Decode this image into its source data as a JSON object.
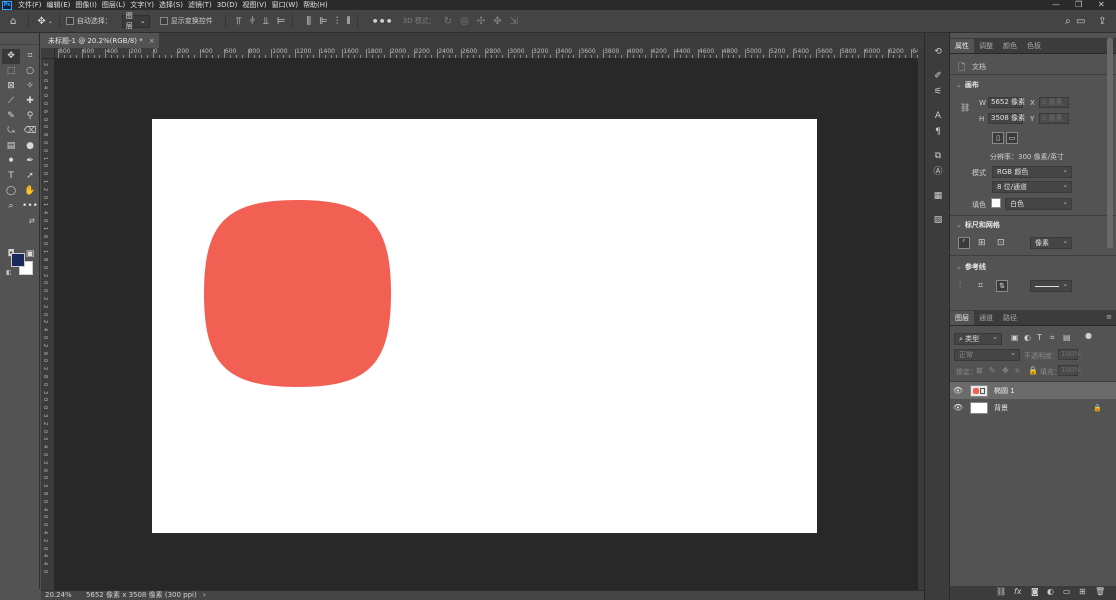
{
  "app": {
    "logo": "Ps"
  },
  "menu": [
    "文件(F)",
    "编辑(E)",
    "图像(I)",
    "图层(L)",
    "文字(Y)",
    "选择(S)",
    "滤镜(T)",
    "3D(D)",
    "视图(V)",
    "窗口(W)",
    "帮助(H)"
  ],
  "window_controls": {
    "minimize": "—",
    "restore": "❐",
    "close": "✕"
  },
  "options": {
    "auto_select_label": "自动选择：",
    "auto_select_target": "图层",
    "show_transform_label": "显示变换控件",
    "mode3d_label": "3D 模式："
  },
  "document_tab": {
    "title": "未标题-1 @ 20.2%(RGB/8) *",
    "close": "×"
  },
  "ruler_top_labels": [
    "800",
    "600",
    "400",
    "200",
    "0",
    "200",
    "400",
    "600",
    "800",
    "1000",
    "1200",
    "1400",
    "1600",
    "1800",
    "2000",
    "2200",
    "2400",
    "2600",
    "2800",
    "3000",
    "3200",
    "3400",
    "3600",
    "3800",
    "4000",
    "4200",
    "4400",
    "4600",
    "4800",
    "5000",
    "5200",
    "5400",
    "5600",
    "5800",
    "6000",
    "6200",
    "6400"
  ],
  "ruler_left_labels": [
    "2",
    "0",
    "0",
    "4",
    "0",
    "0",
    "6",
    "0",
    "0",
    "8",
    "0",
    "0",
    "1",
    "0",
    "0",
    "1",
    "2",
    "0",
    "1",
    "4",
    "0",
    "1",
    "6",
    "0",
    "1",
    "8",
    "0",
    "2",
    "0",
    "0",
    "2",
    "2",
    "0",
    "2",
    "4",
    "0",
    "2",
    "6",
    "0",
    "2",
    "8",
    "0",
    "3",
    "0",
    "0",
    "3",
    "2",
    "0",
    "3",
    "4",
    "0",
    "3",
    "6",
    "0",
    "3",
    "8",
    "0",
    "4",
    "0",
    "0",
    "4",
    "2",
    "0",
    "4",
    "4",
    "0"
  ],
  "status": {
    "zoom": "20.24%",
    "info": "5652 像素 x 3508 像素 (300 ppi)",
    "arrow": "›"
  },
  "colors": {
    "shape": "#f26054",
    "foreground": "#1b2a5c",
    "background": "#ffffff",
    "canvas_bg": "#282828"
  },
  "properties_panel": {
    "tabs": [
      "属性",
      "调整",
      "颜色",
      "色板"
    ],
    "doc_label": "文档",
    "canvas_section": "画布",
    "w_label": "W",
    "w_value": "5652 像素",
    "x_label": "X",
    "x_value": "0 像素",
    "h_label": "H",
    "h_value": "3508 像素",
    "y_label": "Y",
    "y_value": "0 像素",
    "resolution": "分辨率：300 像素/英寸",
    "mode_label": "模式",
    "mode_value": "RGB 颜色",
    "bit_depth": "8 位/通道",
    "fill_label": "填色",
    "fill_value": "白色",
    "rulers_section": "标尺和网格",
    "units_value": "像素",
    "guides_section": "参考线"
  },
  "layers_panel": {
    "tabs": [
      "图层",
      "通道",
      "路径"
    ],
    "filter_kind": "类型",
    "blend_mode": "正常",
    "opacity_label": "不透明度：",
    "opacity_value": "100%",
    "lock_label": "锁定：",
    "fill_label": "填充：",
    "fill_value": "100%",
    "layers": [
      {
        "name": "椭圆 1",
        "visible": true
      },
      {
        "name": "背景",
        "visible": true,
        "locked": true
      }
    ]
  }
}
